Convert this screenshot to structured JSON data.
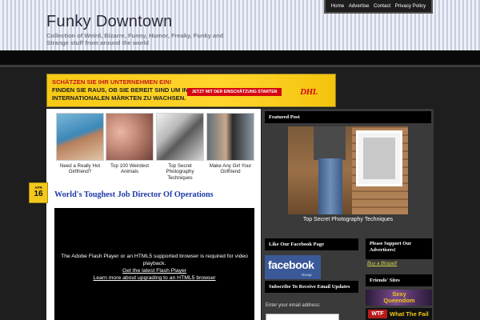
{
  "header": {
    "title": "Funky Downtown",
    "description": "Collection of Weird, Bizarre, Funny, Humor, Freaky, Funky and Strange stuff from around the world"
  },
  "topnav": {
    "items": [
      "Home",
      "Advertise",
      "Contact",
      "Privacy Policy"
    ]
  },
  "banner": {
    "line1": "SCHÄTZEN SIE IHR UNTERNEHMEN EIN!",
    "line2": "FINDEN SIE RAUS, OB SIE BEREIT SIND UM IN",
    "line3": "INTERNATIONALEN MÄRKTEN ZU WACHSEN.",
    "cta": "JETZT MIT DER EINSCHÄTZUNG STARTEN",
    "logo": "DHL",
    "colors": {
      "yellow": "#ffcc00",
      "red": "#d40511"
    }
  },
  "thumbnails": [
    {
      "caption": "Need a Really Hot Girlfriend?"
    },
    {
      "caption": "Top 100 Weirdest Animals"
    },
    {
      "caption": "Top Secret Photography Techniques"
    },
    {
      "caption": "Make Any Girl Your Girlfriend"
    }
  ],
  "post": {
    "date_month": "APR",
    "date_day": "16",
    "title": "World's Toughest Job Director Of Operations"
  },
  "player": {
    "message": "The Adobe Flash Player or an HTML5 supported browser is required for video playback.",
    "link1": "Get the latest Flash Player",
    "link2": "Learn more about upgrading to an HTML5 browser"
  },
  "featured": {
    "heading": "Featured Post",
    "caption": "Top Secret Photography Techniques"
  },
  "facebook": {
    "heading": "Like Our Facebook Page",
    "logo": "facebook",
    "sub": "Group"
  },
  "subscribe": {
    "heading": "Subscribe To Receive Email Updates",
    "label": "Enter your email address:"
  },
  "support": {
    "heading": "Please Support Our Advertisers!",
    "link": "Buy a Blogad!"
  },
  "friends": {
    "heading": "Friends' Sites",
    "site1": "Sexy Queendom",
    "site2_badge": "WTF",
    "site2": "What The Fail"
  }
}
